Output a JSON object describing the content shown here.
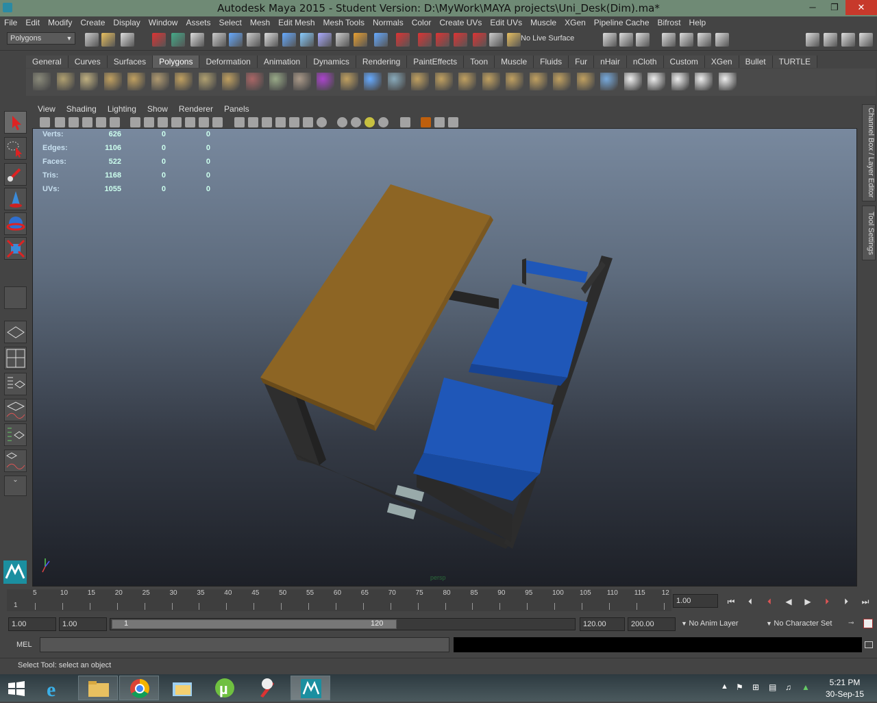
{
  "window": {
    "title": "Autodesk Maya 2015 - Student Version: D:\\MyWork\\MAYA projects\\Uni_Desk(Dim).ma*",
    "minimize": "─",
    "restore": "❐",
    "close": "✕"
  },
  "menus": [
    "File",
    "Edit",
    "Modify",
    "Create",
    "Display",
    "Window",
    "Assets",
    "Select",
    "Mesh",
    "Edit Mesh",
    "Mesh Tools",
    "Normals",
    "Color",
    "Create UVs",
    "Edit UVs",
    "Muscle",
    "XGen",
    "Pipeline Cache",
    "Bifrost",
    "Help"
  ],
  "toolbar": {
    "mode": "Polygons",
    "live_surface": "No Live Surface"
  },
  "shelf_tabs": [
    "General",
    "Curves",
    "Surfaces",
    "Polygons",
    "Deformation",
    "Animation",
    "Dynamics",
    "Rendering",
    "PaintEffects",
    "Toon",
    "Muscle",
    "Fluids",
    "Fur",
    "nHair",
    "nCloth",
    "Custom",
    "XGen",
    "Bullet",
    "TURTLE"
  ],
  "shelf_active": "Polygons",
  "viewport": {
    "menus": [
      "View",
      "Shading",
      "Lighting",
      "Show",
      "Renderer",
      "Panels"
    ],
    "camera": "persp",
    "hud": [
      {
        "label": "Verts:",
        "v1": "626",
        "v2": "0",
        "v3": "0"
      },
      {
        "label": "Edges:",
        "v1": "1106",
        "v2": "0",
        "v3": "0"
      },
      {
        "label": "Faces:",
        "v1": "522",
        "v2": "0",
        "v3": "0"
      },
      {
        "label": "Tris:",
        "v1": "1168",
        "v2": "0",
        "v3": "0"
      },
      {
        "label": "UVs:",
        "v1": "1055",
        "v2": "0",
        "v3": "0"
      }
    ]
  },
  "right_tabs": [
    "Channel Box / Layer Editor",
    "Tool Settings"
  ],
  "timeline": {
    "first_tick": "1",
    "ticks": [
      "5",
      "10",
      "15",
      "20",
      "25",
      "30",
      "35",
      "40",
      "45",
      "50",
      "55",
      "60",
      "65",
      "70",
      "75",
      "80",
      "85",
      "90",
      "95",
      "100",
      "105",
      "110",
      "115",
      "12"
    ],
    "current_frame": "1.00"
  },
  "range": {
    "start": "1.00",
    "playback_start": "1.00",
    "slider_start": "1",
    "slider_end": "120",
    "playback_end": "120.00",
    "end": "200.00",
    "anim_layer": "No Anim Layer",
    "character_set": "No Character Set"
  },
  "mel": {
    "label": "MEL"
  },
  "status": "Select Tool: select an object",
  "clock": {
    "time": "5:21 PM",
    "date": "30-Sep-15"
  },
  "colors": {
    "desk_top": "#8d6524",
    "chair": "#1f57b8",
    "frame": "#2b2b2b"
  }
}
